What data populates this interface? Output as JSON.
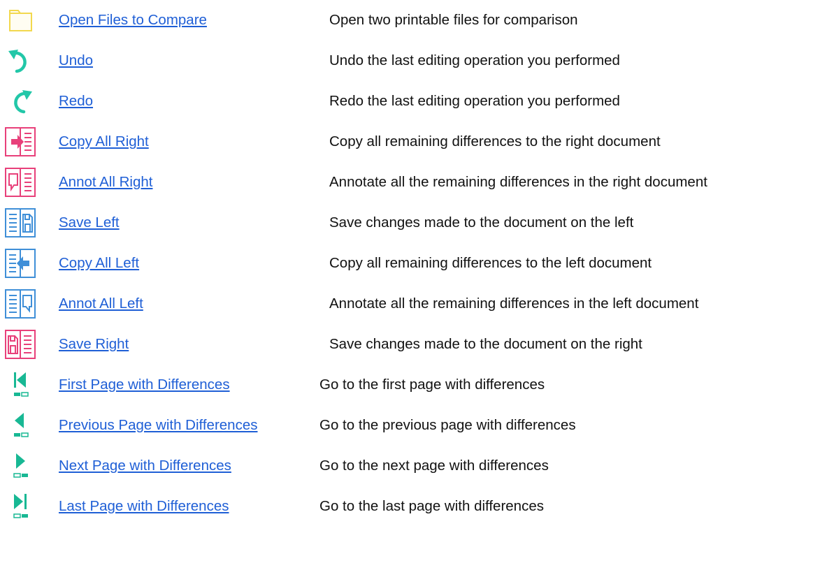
{
  "colors": {
    "link": "#1f5fd6",
    "folder": "#f2d84e",
    "teal": "#22c7a8",
    "pink": "#e8407a",
    "blue": "#3f8fd8",
    "nav": "#18b894"
  },
  "commands": [
    {
      "icon": "folder-icon",
      "label": "Open Files to Compare",
      "description": "Open two printable files for comparison"
    },
    {
      "icon": "undo-icon",
      "label": "Undo",
      "description": "Undo the last editing operation you performed"
    },
    {
      "icon": "redo-icon",
      "label": "Redo",
      "description": "Redo the last editing operation you performed"
    },
    {
      "icon": "copy-all-right-icon",
      "label": "Copy All Right",
      "description": "Copy all remaining differences to the right document"
    },
    {
      "icon": "annot-all-right-icon",
      "label": "Annot All Right",
      "description": "Annotate all the remaining differences in the right document"
    },
    {
      "icon": "save-left-icon",
      "label": "Save Left",
      "description": "Save changes made to the document on the left"
    },
    {
      "icon": "copy-all-left-icon",
      "label": "Copy All Left",
      "description": "Copy all remaining differences to the left document"
    },
    {
      "icon": "annot-all-left-icon",
      "label": "Annot All Left",
      "description": "Annotate all the remaining differences in the left document"
    },
    {
      "icon": "save-right-icon",
      "label": "Save Right",
      "description": "Save changes made to the document on the right"
    },
    {
      "icon": "first-page-icon",
      "label": "First Page with Differences",
      "description": "Go to the first page with differences"
    },
    {
      "icon": "previous-page-icon",
      "label": "Previous Page with Differences",
      "description": "Go to the previous page with differences"
    },
    {
      "icon": "next-page-icon",
      "label": "Next Page with Differences",
      "description": "Go to the next page with differences"
    },
    {
      "icon": "last-page-icon",
      "label": "Last Page with Differences",
      "description": "Go to the last page with differences"
    }
  ]
}
